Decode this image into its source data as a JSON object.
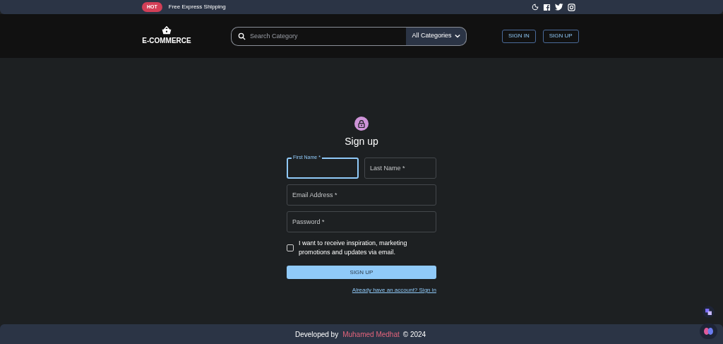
{
  "top_bar": {
    "badge": "HOT",
    "promo": "Free Express Shipping"
  },
  "header": {
    "logo": "E-COMMERCE",
    "search": {
      "placeholder": "Search Category"
    },
    "category": "All Categories",
    "buttons": [
      "SIGN IN",
      "SIGN UP"
    ]
  },
  "form": {
    "title": "Sign up",
    "fields": [
      {
        "label": "First Name",
        "required": "*",
        "focused": true
      },
      {
        "label": "Last Name",
        "required": "*",
        "focused": false
      },
      {
        "label": "Email Address",
        "required": "*",
        "focused": false
      },
      {
        "label": "Password",
        "required": "*",
        "focused": false
      }
    ],
    "checkbox": {
      "label": "I want to receive inspiration, marketing promotions and updates via email.",
      "checked": false
    },
    "submit": "SIGN UP",
    "link": "Already have an account? Sign in"
  },
  "footer": {
    "prefix": "Developed by",
    "author": "Muhamed Medhat",
    "suffix": "© 2024"
  }
}
